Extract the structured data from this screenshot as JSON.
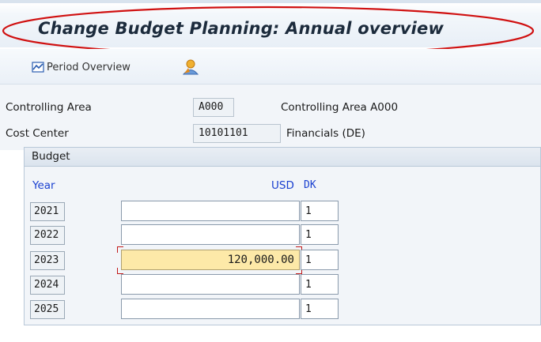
{
  "title": "Change Budget Planning: Annual overview",
  "toolbar": {
    "period_overview_label": "Period Overview"
  },
  "header": {
    "controlling_area_label": "Controlling Area",
    "controlling_area_value": "A000",
    "controlling_area_desc": "Controlling Area A000",
    "cost_center_label": "Cost Center",
    "cost_center_value": "10101101",
    "cost_center_desc": "Financials (DE)"
  },
  "budget": {
    "section_label": "Budget",
    "col_year": "Year",
    "col_currency": "USD",
    "col_dk": "DK",
    "rows": [
      {
        "year": "2021",
        "amount": "",
        "dk": "1"
      },
      {
        "year": "2022",
        "amount": "",
        "dk": "1"
      },
      {
        "year": "2023",
        "amount": "120,000.00",
        "dk": "1"
      },
      {
        "year": "2024",
        "amount": "",
        "dk": "1"
      },
      {
        "year": "2025",
        "amount": "",
        "dk": "1"
      }
    ]
  },
  "colors": {
    "annotation": "#d01010",
    "column_header": "#1a40d0",
    "active_field": "#fde9a8"
  }
}
